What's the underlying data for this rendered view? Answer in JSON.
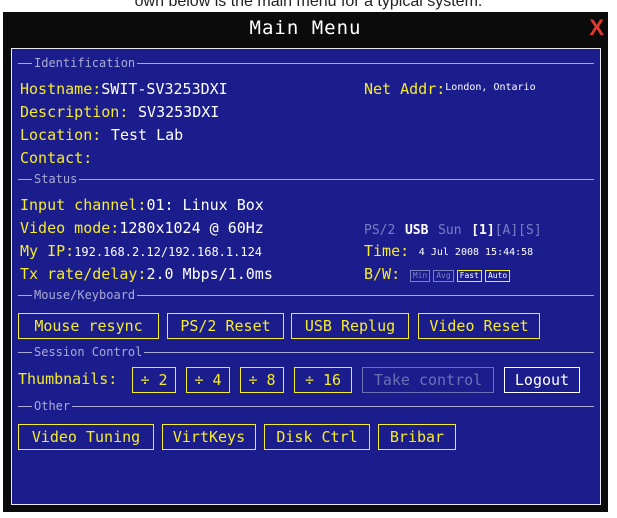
{
  "caption": "own below is the main menu for a typical system.",
  "window": {
    "title": "Main Menu",
    "close_label": "X"
  },
  "sections": {
    "identification": "Identification",
    "status": "Status",
    "mouse_keyboard": "Mouse/Keyboard",
    "session_control": "Session Control",
    "other": "Other"
  },
  "identification": {
    "hostname_label": "Hostname:",
    "hostname_value": "SWIT-SV3253DXI",
    "netaddr_label": "Net Addr:",
    "netaddr_value": "London, Ontario",
    "description_label": "Description:",
    "description_value": "SV3253DXI",
    "location_label": "Location:",
    "location_value": "Test Lab",
    "contact_label": "Contact:",
    "contact_value": ""
  },
  "status": {
    "input_channel_label": "Input channel:",
    "input_channel_value": "01: Linux Box",
    "video_mode_label": "Video mode:",
    "video_mode_value": "1280x1024 @ 60Hz",
    "kbd_ps2": "PS/2",
    "kbd_usb": "USB",
    "kbd_sun": "Sun",
    "kbd_ch1": "[1]",
    "kbd_a": "[A]",
    "kbd_s": "[S]",
    "my_ip_label": "My IP:",
    "my_ip_value": "192.168.2.12/192.168.1.124",
    "time_label": "Time:",
    "time_value": "4 Jul 2008 15:44:58",
    "tx_label": "Tx rate/delay:",
    "tx_value": "2.0 Mbps/1.0ms",
    "bw_label": "B/W:",
    "bw_options": {
      "min": "Min",
      "avg": "Avg",
      "fast": "Fast",
      "auto": "Auto"
    }
  },
  "mouse_keyboard": {
    "mouse_resync": "Mouse resync",
    "ps2_reset": "PS/2 Reset",
    "usb_replug": "USB Replug",
    "video_reset": "Video Reset"
  },
  "session_control": {
    "thumbnails_label": "Thumbnails:",
    "t2": "÷ 2",
    "t4": "÷ 4",
    "t8": "÷ 8",
    "t16": "÷ 16",
    "take_control": "Take control",
    "logout": "Logout"
  },
  "other": {
    "video_tuning": "Video Tuning",
    "virtkeys": "VirtKeys",
    "disk_ctrl": "Disk Ctrl",
    "bribar": "Bribar"
  },
  "colors": {
    "panel_bg": "#1c1d8c",
    "label_yellow": "#f5ec2a",
    "value_white": "#ffffff",
    "dim_text": "#7c7ec4",
    "close_red": "#e23a2e",
    "titlebar_black": "#0b0b0b"
  }
}
